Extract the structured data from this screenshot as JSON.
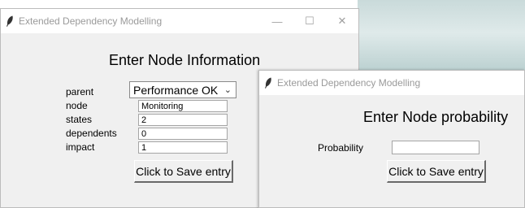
{
  "window1": {
    "title": "Extended Dependency Modelling",
    "controls": {
      "minimize": "—",
      "maximize": "☐",
      "close": "✕"
    },
    "heading": "Enter Node Information",
    "fields": {
      "parent": {
        "label": "parent",
        "value": "Performance OK"
      },
      "node": {
        "label": "node",
        "value": "Monitoring"
      },
      "states": {
        "label": "states",
        "value": "2"
      },
      "dependents": {
        "label": "dependents",
        "value": "0"
      },
      "impact": {
        "label": "impact",
        "value": "1"
      }
    },
    "save_button": "Click to Save entry"
  },
  "window2": {
    "title": "Extended Dependency Modelling",
    "heading": "Enter Node probability",
    "probability_label": "Probability",
    "probability_value": "",
    "save_button": "Click to Save entry"
  },
  "icons": {
    "app": "feather-icon",
    "dropdown": "chevron-down-icon"
  }
}
